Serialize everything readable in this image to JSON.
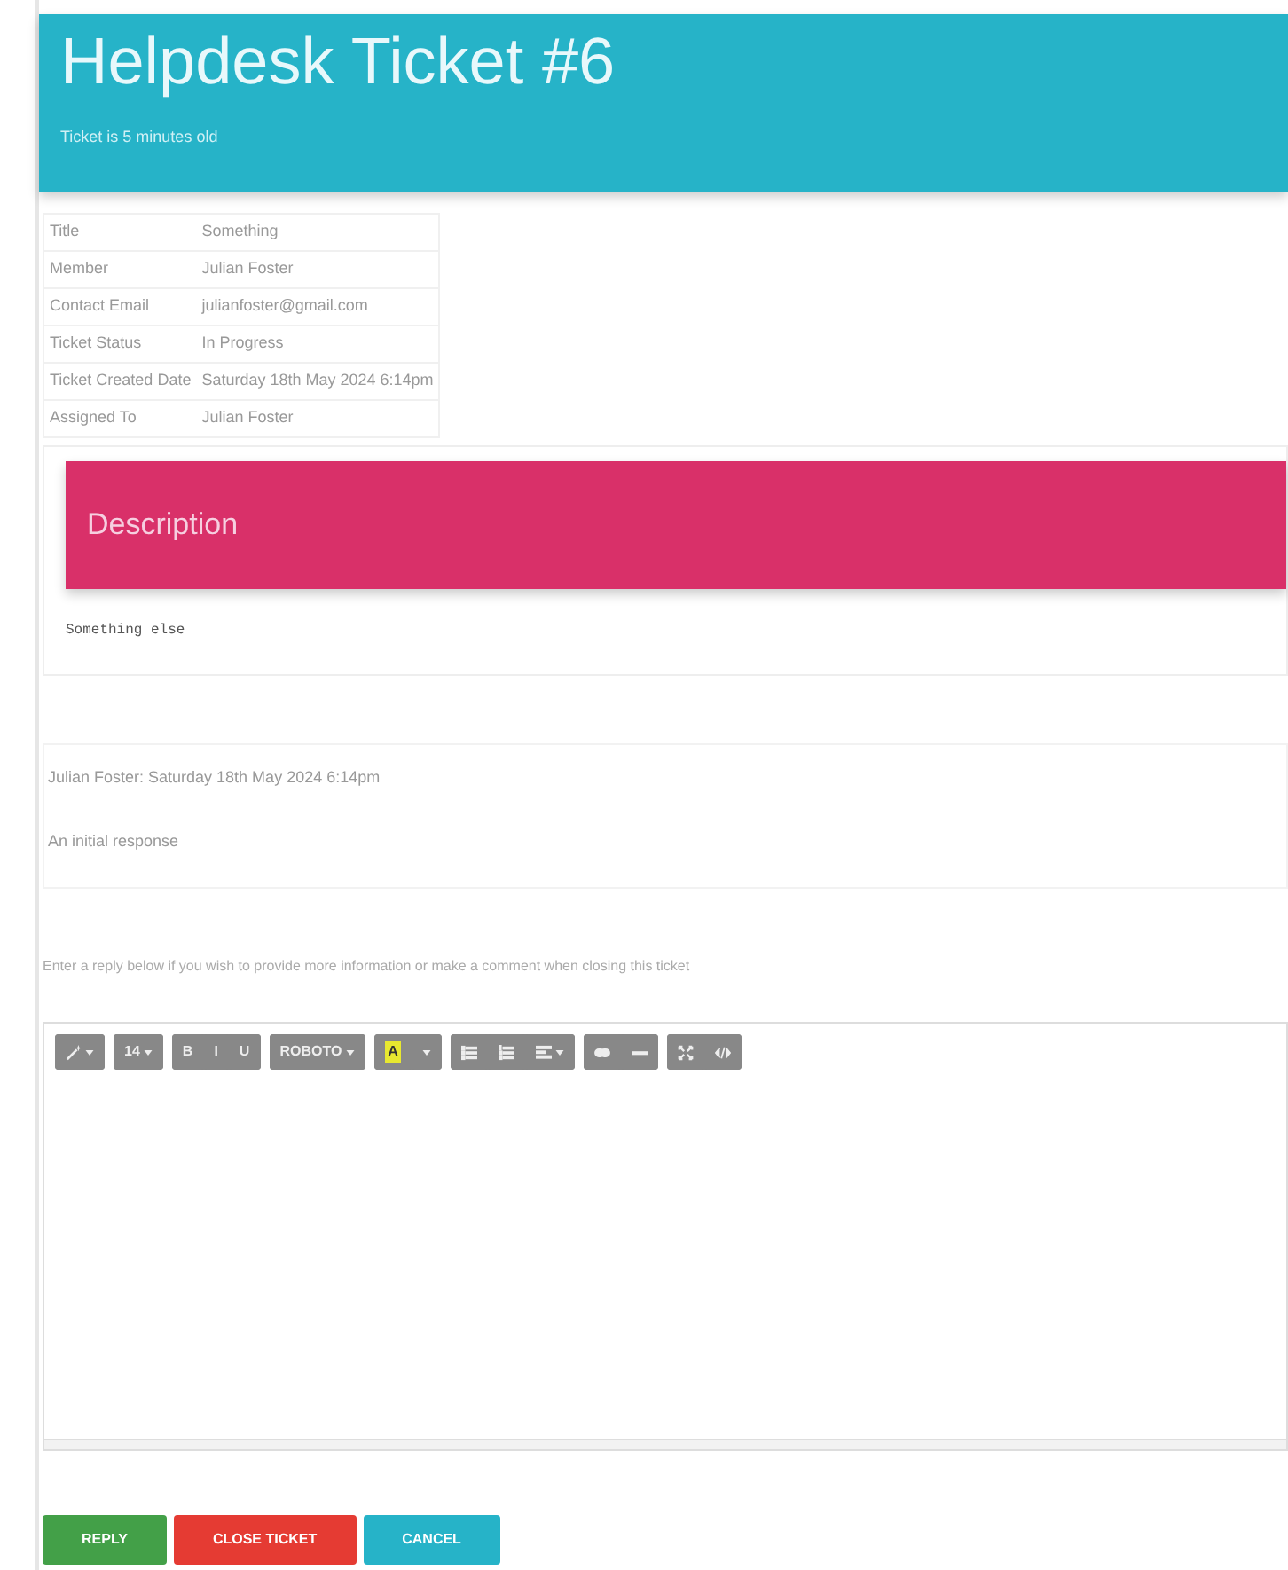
{
  "header": {
    "title": "Helpdesk Ticket #6",
    "subtitle": "Ticket is 5 minutes old"
  },
  "details": [
    {
      "label": "Title",
      "value": "Something"
    },
    {
      "label": "Member",
      "value": "Julian Foster"
    },
    {
      "label": "Contact Email",
      "value": "julianfoster@gmail.com"
    },
    {
      "label": "Ticket Status",
      "value": "In Progress"
    },
    {
      "label": "Ticket Created Date",
      "value": "Saturday 18th May 2024 6:14pm"
    },
    {
      "label": "Assigned To",
      "value": "Julian Foster"
    }
  ],
  "description": {
    "heading": "Description",
    "body": "Something else"
  },
  "responses": [
    {
      "author_line": "Julian Foster: Saturday 18th May 2024 6:14pm",
      "body": "An initial response"
    }
  ],
  "instruction": "Enter a reply below if you wish to provide more information or make a comment when closing this ticket",
  "toolbar": [
    [
      {
        "kind": "magic"
      }
    ],
    [
      {
        "kind": "text-caret",
        "label": "14"
      }
    ],
    [
      {
        "kind": "text",
        "label": "B"
      },
      {
        "kind": "text",
        "label": "I"
      },
      {
        "kind": "text",
        "label": "U"
      }
    ],
    [
      {
        "kind": "text-caret",
        "label": "ROBOTO"
      }
    ],
    [
      {
        "kind": "color",
        "label": "A"
      },
      {
        "kind": "caret"
      }
    ],
    [
      {
        "kind": "ul"
      },
      {
        "kind": "ol"
      },
      {
        "kind": "align"
      }
    ],
    [
      {
        "kind": "link"
      },
      {
        "kind": "hr"
      }
    ],
    [
      {
        "kind": "fullscreen"
      },
      {
        "kind": "code"
      }
    ]
  ],
  "buttons": [
    {
      "label": "REPLY",
      "kind": "success"
    },
    {
      "label": "CLOSE TICKET",
      "kind": "danger"
    },
    {
      "label": "CANCEL",
      "kind": "info"
    }
  ]
}
